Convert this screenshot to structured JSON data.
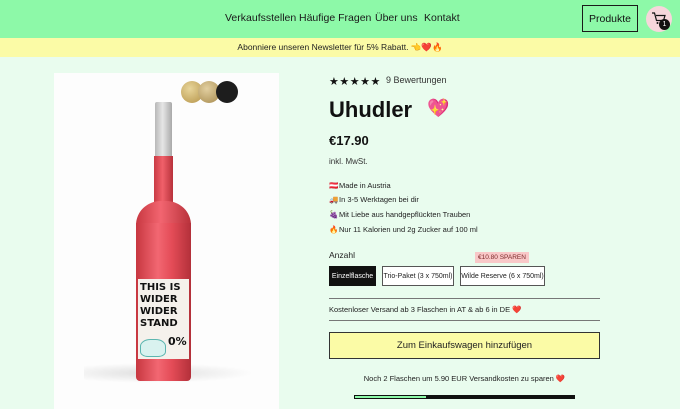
{
  "nav": {
    "items": [
      "Verkaufsstellen",
      "Häufige Fragen",
      "Über uns",
      "Kontakt"
    ],
    "products_label": "Produkte",
    "cart_count": "1"
  },
  "newsletter": {
    "text": "Abonniere unseren Newsletter für 5% Rabatt. 👈❤️🔥"
  },
  "product": {
    "rating_stars": "★★★★★",
    "reviews": "9 Bewertungen",
    "name": "Uhudler",
    "name_emoji": "💖",
    "price": "€17.90",
    "tax_note": "inkl. MwSt.",
    "bottle_label": {
      "lines": [
        "THIS IS",
        "WIDER",
        "WIDER",
        "STAND"
      ],
      "percent": "0%"
    },
    "features": [
      {
        "icon": "🇦🇹",
        "text": "Made in Austria"
      },
      {
        "icon": "🚚",
        "text": "In 3-5 Werktagen bei dir"
      },
      {
        "icon": "🍇",
        "text": "Mit Liebe aus handgepflückten Trauben"
      },
      {
        "icon": "🔥",
        "text": "Nur 11 Kalorien und 2g Zucker auf 100 ml"
      }
    ],
    "quantity_label": "Anzahl",
    "save_badge": "€10.80 SPAREN",
    "options": [
      "Einzelflasche",
      "Trio-Paket (3 x 750ml)",
      "Wilde Reserve (6 x 750ml)"
    ],
    "selected_option": "Einzelflasche",
    "shipping_note": "Kostenloser Versand ab 3 Flaschen in AT & ab 6 in DE ❤️",
    "add_to_cart": "Zum Einkaufswagen hinzufügen",
    "remaining_note": "Noch 2 Flaschen um 5.90 EUR Versandkosten zu sparen ❤️",
    "shipping_progress": 0.33
  },
  "colors": {
    "accent_green": "#8df9a8",
    "banner_yellow": "#fbfba6",
    "page_bg": "#e9fcee",
    "bottle_red": "#e44c57"
  }
}
